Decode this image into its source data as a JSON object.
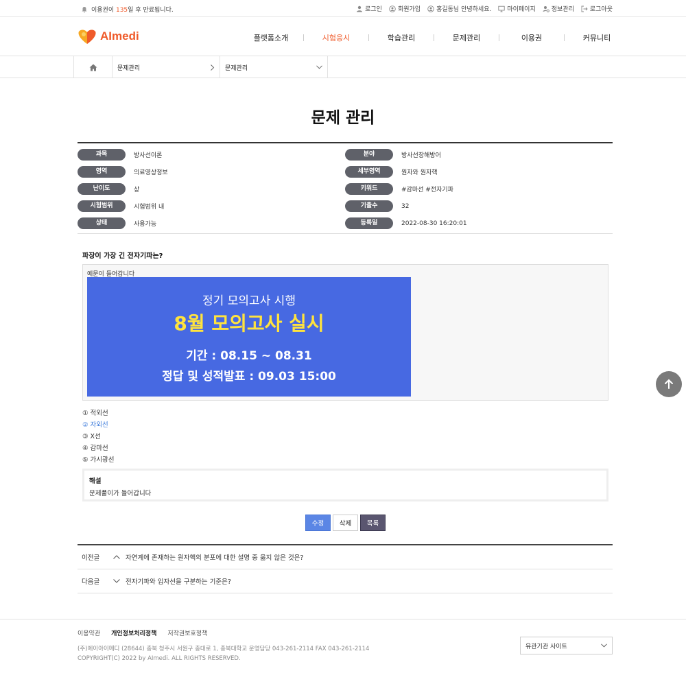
{
  "topbar": {
    "notice_prefix": "이용권이 ",
    "notice_days": "135",
    "notice_suffix": "일 후 만료됩니다.",
    "links": [
      "로그인",
      "회원가입",
      "홍길동님 안녕하세요.",
      "마이페이지",
      "정보관리",
      "로그아웃"
    ]
  },
  "header": {
    "logo": "AImedi",
    "menu": [
      "플랫폼소개",
      "시험응시",
      "학습관리",
      "문제관리",
      "이용권",
      "커뮤니티"
    ],
    "active": "시험응시"
  },
  "breadcrumb": [
    "문제관리",
    "문제관리"
  ],
  "page_title": "문제 관리",
  "info": {
    "left": [
      {
        "label": "과목",
        "value": "방사선이론"
      },
      {
        "label": "영역",
        "value": "의료영상정보"
      },
      {
        "label": "난이도",
        "value": "상"
      },
      {
        "label": "시험범위",
        "value": "시험범위 내"
      },
      {
        "label": "상태",
        "value": "사용가능"
      }
    ],
    "right": [
      {
        "label": "분야",
        "value": "방사선장해방어"
      },
      {
        "label": "세부영역",
        "value": "원자와 원자핵"
      },
      {
        "label": "키워드",
        "value": "#감마선 #전자기파"
      },
      {
        "label": "기출수",
        "value": "32"
      },
      {
        "label": "등록일",
        "value": "2022-08-30 16:20:01"
      }
    ]
  },
  "question": {
    "title": "파장이 가장 긴 전자기파는?",
    "example_text": "예문이 들어갑니다",
    "banner": {
      "line1": "정기 모의고사 시행",
      "line2": "8월 모의고사 실시",
      "line3": "기간 : 08.15 ~ 08.31",
      "line4": "정답 및 성적발표 : 09.03 15:00"
    },
    "choices": [
      "① 적외선",
      "② 자외선",
      "③ X선",
      "④ 감마선",
      "⑤ 가시광선"
    ],
    "answer_index": 1
  },
  "explanation": {
    "heading": "해설",
    "text": "문제풀이가 들어갑니다"
  },
  "buttons": {
    "edit": "수정",
    "delete": "삭제",
    "list": "목록"
  },
  "nav": {
    "prev_label": "이전글",
    "prev_title": "자연계에 존재하는 원자핵의 분포에 대한 설명 중 옳지 않은 것은?",
    "next_label": "다음글",
    "next_title": "전자기파와 입자선을 구분하는 기준은?"
  },
  "footer": {
    "links": [
      "이용약관",
      "개인정보처리정책",
      "저작권보호정책"
    ],
    "address": "(주)에이아이메디   (28644) 충북 청주시 서원구 충대로 1, 충북대학교   운영담당 043-261-2114   FAX 043-261-2114",
    "copyright": "COPYRIGHT(C) 2022 by AImedi.    ALL RIGHTS RESERVED.",
    "related_site": "유관기관 사이트"
  },
  "colors": {
    "accent": "#ef5a2a",
    "tag": "#5f6169",
    "banner": "#4769e2",
    "banner_highlight": "#ffe33d",
    "answer": "#3d7bdb"
  }
}
